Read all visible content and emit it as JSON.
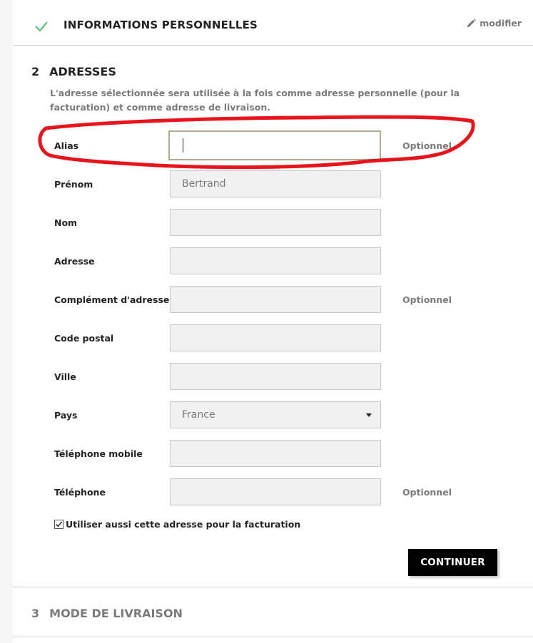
{
  "step1": {
    "title": "INFORMATIONS PERSONNELLES",
    "edit_label": "modifier",
    "check_color": "#4cbb6c"
  },
  "step2": {
    "number": "2",
    "title": "ADRESSES",
    "intro": "L'adresse sélectionnée sera utilisée à la fois comme adresse personnelle (pour la facturation) et comme adresse de livraison.",
    "optional_label": "Optionnel",
    "fields": {
      "alias": {
        "label": "Alias",
        "value": ""
      },
      "prenom": {
        "label": "Prénom",
        "value": "Bertrand"
      },
      "nom": {
        "label": "Nom",
        "value": ""
      },
      "adresse": {
        "label": "Adresse",
        "value": ""
      },
      "complement": {
        "label": "Complément d'adresse",
        "value": ""
      },
      "code_postal": {
        "label": "Code postal",
        "value": ""
      },
      "ville": {
        "label": "Ville",
        "value": ""
      },
      "pays": {
        "label": "Pays",
        "value": "France"
      },
      "tel_mobile": {
        "label": "Téléphone mobile",
        "value": ""
      },
      "telephone": {
        "label": "Téléphone",
        "value": ""
      }
    },
    "use_for_billing": {
      "label": "Utiliser aussi cette adresse pour la facturation",
      "checked": true
    },
    "continue_label": "CONTINUER"
  },
  "step3": {
    "number": "3",
    "title": "MODE DE LIVRAISON"
  },
  "colors": {
    "annotation": "#e8141b",
    "focus_border": "#b4ab8b"
  }
}
